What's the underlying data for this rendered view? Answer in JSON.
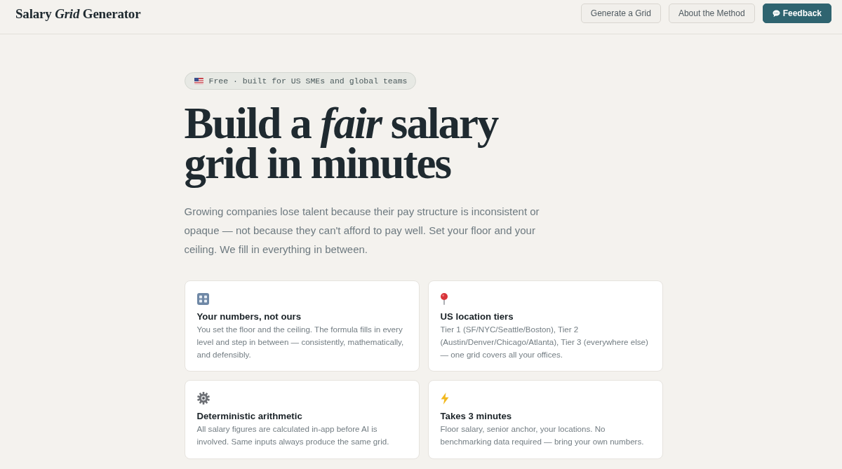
{
  "header": {
    "logo": "Salary *Grid* Generator",
    "nav": [
      {
        "label": "Generate a Grid",
        "kind": "secondary"
      },
      {
        "label": "About the Method",
        "kind": "secondary"
      },
      {
        "label": "Feedback",
        "kind": "primary"
      }
    ]
  },
  "hero": {
    "badge": "Free · built for US SMEs and global teams",
    "headline": "Build a *fair* salary grid in minutes",
    "lead": "Growing companies lose talent because their pay structure is inconsistent or opaque — not because they can't afford to pay well. Set your floor and your ceiling. We fill in everything in between."
  },
  "features": [
    {
      "title": "Your numbers, not ours",
      "text": "You set the floor and the ceiling. The formula fills in every level and step in between — consistently, mathematically, and defensibly."
    },
    {
      "title": "US location tiers",
      "text": "Tier 1 (SF/NYC/Seattle/Boston), Tier 2 (Austin/Denver/Chicago/Atlanta), Tier 3 (everywhere else) — one grid covers all your offices."
    },
    {
      "title": "Deterministic arithmetic",
      "text": "All salary figures are calculated in-app before AI is involved. Same inputs always produce the same grid."
    },
    {
      "title": "Takes 3 minutes",
      "text": "Floor salary, senior anchor, your locations. No benchmarking data required — bring your own numbers."
    }
  ]
}
